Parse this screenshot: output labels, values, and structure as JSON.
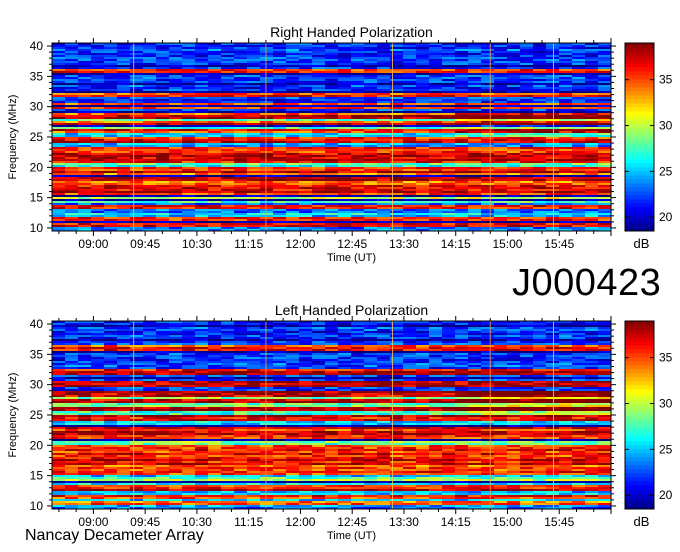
{
  "observation_id": "J000423",
  "footer_label": "Nancay Decameter Array",
  "chart_data": [
    {
      "type": "heatmap",
      "title": "Right Handed Polarization",
      "xlabel": "Time (UT)",
      "ylabel": "Frequency (MHz)",
      "x_ticks": [
        "09:00",
        "09:45",
        "10:30",
        "11:15",
        "12:00",
        "12:45",
        "13:30",
        "14:15",
        "15:00",
        "15:45"
      ],
      "x_range_hours": [
        8.4,
        16.5
      ],
      "y_ticks": [
        10,
        15,
        20,
        25,
        30,
        35,
        40
      ],
      "ylim": [
        9.5,
        40.5
      ],
      "colorbar": {
        "label": "dB",
        "ticks": [
          20,
          25,
          30,
          35
        ],
        "range": [
          18.5,
          39
        ]
      },
      "interference_bands_mhz": [
        10.5,
        11.5,
        13.5,
        15.5,
        16.6,
        17.6,
        18.6,
        19.6,
        21.2,
        21.8,
        22.8,
        24.5,
        26.0,
        27.3,
        28.4,
        30.0,
        32.0,
        35.8
      ],
      "vertical_markers_ut": [
        "09:35",
        "11:30",
        "13:20",
        "14:45",
        "15:40"
      ]
    },
    {
      "type": "heatmap",
      "title": "Left Handed Polarization",
      "xlabel": "Time (UT)",
      "ylabel": "Frequency (MHz)",
      "x_ticks": [
        "09:00",
        "09:45",
        "10:30",
        "11:15",
        "12:00",
        "12:45",
        "13:30",
        "14:15",
        "15:00",
        "15:45"
      ],
      "x_range_hours": [
        8.4,
        16.5
      ],
      "y_ticks": [
        10,
        15,
        20,
        25,
        30,
        35,
        40
      ],
      "ylim": [
        9.5,
        40.5
      ],
      "colorbar": {
        "label": "dB",
        "ticks": [
          20,
          25,
          30,
          35
        ],
        "range": [
          18.5,
          39
        ]
      },
      "interference_bands_mhz": [
        10.5,
        11.5,
        13.0,
        15.5,
        16.6,
        17.6,
        18.6,
        19.6,
        21.2,
        21.8,
        22.8,
        24.5,
        26.0,
        27.3,
        28.4,
        30.0,
        32.0,
        36.0
      ],
      "vertical_markers_ut": [
        "09:35",
        "11:30",
        "13:20",
        "14:45",
        "15:40"
      ]
    }
  ]
}
